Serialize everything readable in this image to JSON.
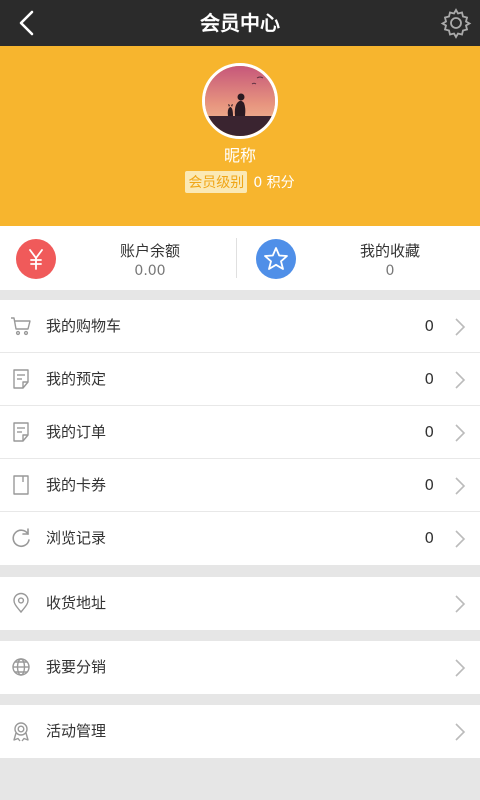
{
  "header": {
    "title": "会员中心"
  },
  "profile": {
    "nickname": "昵称",
    "level": "会员级别",
    "points": "0 积分"
  },
  "stats": {
    "balance": {
      "label": "账户余额",
      "value": "0.00",
      "icon": "yen-icon",
      "color": "#f05a5a"
    },
    "favorites": {
      "label": "我的收藏",
      "value": "0",
      "icon": "star-icon",
      "color": "#4f8fe8"
    }
  },
  "menu": {
    "cart": {
      "label": "我的购物车",
      "count": "0"
    },
    "booking": {
      "label": "我的预定",
      "count": "0"
    },
    "orders": {
      "label": "我的订单",
      "count": "0"
    },
    "coupons": {
      "label": "我的卡券",
      "count": "0"
    },
    "history": {
      "label": "浏览记录",
      "count": "0"
    },
    "address": {
      "label": "收货地址"
    },
    "distribution": {
      "label": "我要分销"
    },
    "activity": {
      "label": "活动管理"
    }
  },
  "colors": {
    "topbar": "#2b2b2b",
    "profile_bg": "#f7b52e",
    "page_bg": "#e6e6e6"
  }
}
